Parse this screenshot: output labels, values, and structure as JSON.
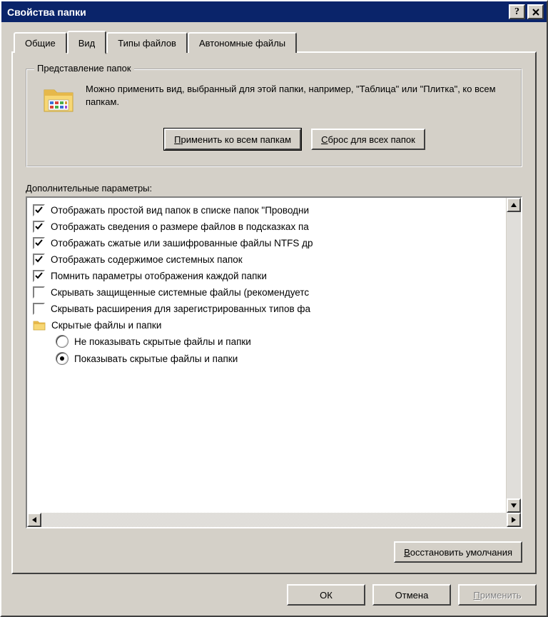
{
  "title": "Свойства папки",
  "tabs": [
    "Общие",
    "Вид",
    "Типы файлов",
    "Автономные файлы"
  ],
  "active_tab": 1,
  "group": {
    "legend": "Представление папок",
    "text": "Можно применить вид, выбранный для этой папки, например, \"Таблица\" или \"Плитка\", ко всем папкам.",
    "apply_btn": "Применить ко всем папкам",
    "reset_btn": "Сброс для всех папок"
  },
  "advanced_label": "Дополнительные параметры:",
  "items": [
    {
      "type": "check",
      "checked": true,
      "label": "Отображать простой вид папок в списке папок \"Проводни"
    },
    {
      "type": "check",
      "checked": true,
      "label": "Отображать сведения о размере файлов в подсказках па"
    },
    {
      "type": "check",
      "checked": true,
      "label": "Отображать сжатые или зашифрованные файлы NTFS др"
    },
    {
      "type": "check",
      "checked": true,
      "label": "Отображать содержимое системных папок"
    },
    {
      "type": "check",
      "checked": true,
      "label": "Помнить параметры отображения каждой папки"
    },
    {
      "type": "check",
      "checked": false,
      "label": "Скрывать защищенные системные файлы (рекомендуетс"
    },
    {
      "type": "check",
      "checked": false,
      "label": "Скрывать расширения для зарегистрированных типов фа"
    },
    {
      "type": "folder",
      "label": "Скрытые файлы и папки"
    },
    {
      "type": "radio",
      "selected": false,
      "label": "Не показывать скрытые файлы и папки",
      "sub": true
    },
    {
      "type": "radio",
      "selected": true,
      "label": "Показывать скрытые файлы и папки",
      "sub": true
    }
  ],
  "restore_btn": "Восстановить умолчания",
  "footer": {
    "ok": "ОК",
    "cancel": "Отмена",
    "apply": "Применить"
  }
}
